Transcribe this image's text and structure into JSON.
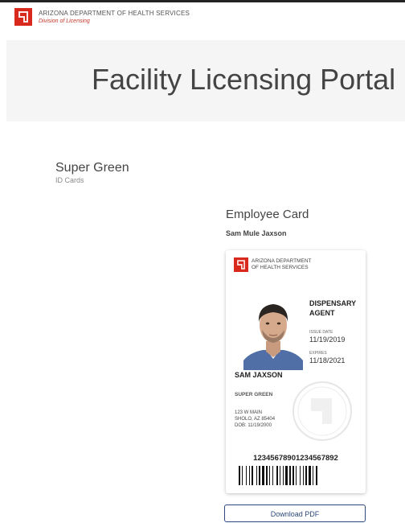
{
  "header": {
    "org_name": "ARIZONA DEPARTMENT OF HEALTH SERVICES",
    "division": "Division of Licensing",
    "logo_icon": "arizona-state-logo-icon",
    "brand_color": "#d9291c"
  },
  "banner": {
    "title": "Facility Licensing Portal"
  },
  "facility": {
    "name": "Super Green",
    "subtitle": "ID Cards"
  },
  "employee_section": {
    "title": "Employee Card",
    "employee_name": "Sam Mule Jaxson"
  },
  "id_card": {
    "org_name": "ARIZONA DEPARTMENT OF HEALTH SERVICES",
    "role": "DISPENSARY AGENT",
    "issue_label": "ISSUE DATE",
    "issue_date": "11/19/2019",
    "expires_label": "EXPIRES",
    "expires_date": "11/18/2021",
    "holder_name": "SAM JAXSON",
    "facility_name": "SUPER GREEN",
    "address_line1": "123 W MAIN",
    "address_line2": "SHOLO, AZ 85404",
    "dob_line": "DOB: 11/19/2000",
    "card_number": "12345678901234567892",
    "photo_icon": "employee-photo",
    "seal_icon": "state-seal-watermark-icon",
    "barcode_icon": "barcode-icon"
  },
  "actions": {
    "download_label": "Download PDF"
  }
}
